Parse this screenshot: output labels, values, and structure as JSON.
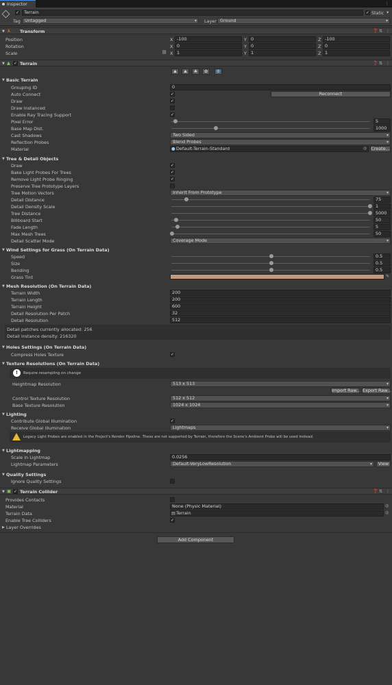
{
  "window": {
    "tab_label": "Inspector"
  },
  "object": {
    "name": "Terrain",
    "static_label": "Static",
    "tag_label": "Tag",
    "tag_value": "Untagged",
    "layer_label": "Layer",
    "layer_value": "Ground"
  },
  "transform": {
    "title": "Transform",
    "position_label": "Position",
    "rotation_label": "Rotation",
    "scale_label": "Scale",
    "x_label": "X",
    "y_label": "Y",
    "z_label": "Z",
    "position": {
      "x": "-100",
      "y": "0",
      "z": "-100"
    },
    "rotation": {
      "x": "0",
      "y": "0",
      "z": "0"
    },
    "scale": {
      "x": "1",
      "y": "1",
      "z": "1"
    }
  },
  "terrain": {
    "title": "Terrain",
    "basic": {
      "title": "Basic Terrain",
      "grouping_id_label": "Grouping ID",
      "grouping_id_value": "0",
      "auto_connect_label": "Auto Connect",
      "reconnect_label": "Reconnect",
      "draw_label": "Draw",
      "draw_instanced_label": "Draw Instanced",
      "ray_tracing_label": "Enable Ray Tracing Support",
      "pixel_error_label": "Pixel Error",
      "pixel_error_value": "5",
      "base_map_label": "Base Map Dist.",
      "base_map_value": "1000",
      "cast_shadows_label": "Cast Shadows",
      "cast_shadows_value": "Two Sided",
      "reflection_label": "Reflection Probes",
      "reflection_value": "Blend Probes",
      "material_label": "Material",
      "material_value": "Default-Terrain-Standard",
      "create_label": "Create..."
    },
    "tree_detail": {
      "title": "Tree & Detail Objects",
      "draw_label": "Draw",
      "bake_probes_label": "Bake Light Probes For Trees",
      "remove_ringing_label": "Remove Light Probe Ringing",
      "preserve_layers_label": "Preserve Tree Prototype Layers",
      "motion_vectors_label": "Tree Motion Vectors",
      "motion_vectors_value": "Inherit From Prototype",
      "detail_distance_label": "Detail Distance",
      "detail_distance_value": "75",
      "detail_density_label": "Detail Density Scale",
      "detail_density_value": "1",
      "tree_distance_label": "Tree Distance",
      "tree_distance_value": "5000",
      "billboard_label": "Billboard Start",
      "billboard_value": "50",
      "fade_label": "Fade Length",
      "fade_value": "5",
      "max_mesh_label": "Max Mesh Trees",
      "max_mesh_value": "50",
      "scatter_label": "Detail Scatter Mode",
      "scatter_value": "Coverage Mode"
    },
    "wind": {
      "title": "Wind Settings for Grass (On Terrain Data)",
      "speed_label": "Speed",
      "speed_value": "0.5",
      "size_label": "Size",
      "size_value": "0.5",
      "bending_label": "Bending",
      "bending_value": "0.5",
      "tint_label": "Grass Tint",
      "tint_color": "#c49a7e"
    },
    "mesh": {
      "title": "Mesh Resolution (On Terrain Data)",
      "width_label": "Terrain Width",
      "width_value": "200",
      "length_label": "Terrain Length",
      "length_value": "200",
      "height_label": "Terrain Height",
      "height_value": "600",
      "per_patch_label": "Detail Resolution Per Patch",
      "per_patch_value": "32",
      "detail_res_label": "Detail Resolution",
      "detail_res_value": "512",
      "info_patches": "Detail patches currently allocated: 256",
      "info_density": "Detail instance density: 216320"
    },
    "holes": {
      "title": "Holes Settings (On Terrain Data)",
      "compress_label": "Compress Holes Texture"
    },
    "texture": {
      "title": "Texture Resolutions (On Terrain Data)",
      "resample_note": "Require resampling on change",
      "heightmap_label": "Heightmap Resolution",
      "heightmap_value": "513 x 513",
      "import_label": "Import Raw...",
      "export_label": "Export Raw...",
      "control_label": "Control Texture Resolution",
      "control_value": "512 x 512",
      "base_label": "Base Texture Resolution",
      "base_value": "1024 x 1024"
    },
    "lighting": {
      "title": "Lighting",
      "contribute_gi_label": "Contribute Global Illumination",
      "receive_gi_label": "Receive Global Illumination",
      "receive_gi_value": "Lightmaps",
      "warning": "Legacy Light Probes are enabled in the Project's Render Pipeline. These are not supported by Terrain, therefore the Scene's Ambient Probe will be used instead."
    },
    "lightmapping": {
      "title": "Lightmapping",
      "scale_label": "Scale In Lightmap",
      "scale_value": "0.0256",
      "params_label": "Lightmap Parameters",
      "params_value": "Default-VeryLowResolution",
      "view_label": "View"
    },
    "quality": {
      "title": "Quality Settings",
      "ignore_label": "Ignore Quality Settings"
    }
  },
  "collider": {
    "title": "Terrain Collider",
    "contacts_label": "Provides Contacts",
    "material_label": "Material",
    "material_value": "None (Physic Material)",
    "data_label": "Terrain Data",
    "data_value": "Terrain",
    "tree_colliders_label": "Enable Tree Colliders",
    "layer_overrides_label": "Layer Overrides"
  },
  "add_component_label": "Add Component",
  "colors": {
    "tab_accent": "#4c8fe0",
    "active_tool": "#46607f",
    "warning_icon": "#e8b830",
    "info_icon": "#ffffff",
    "grass_tint": "#c49a7e"
  }
}
